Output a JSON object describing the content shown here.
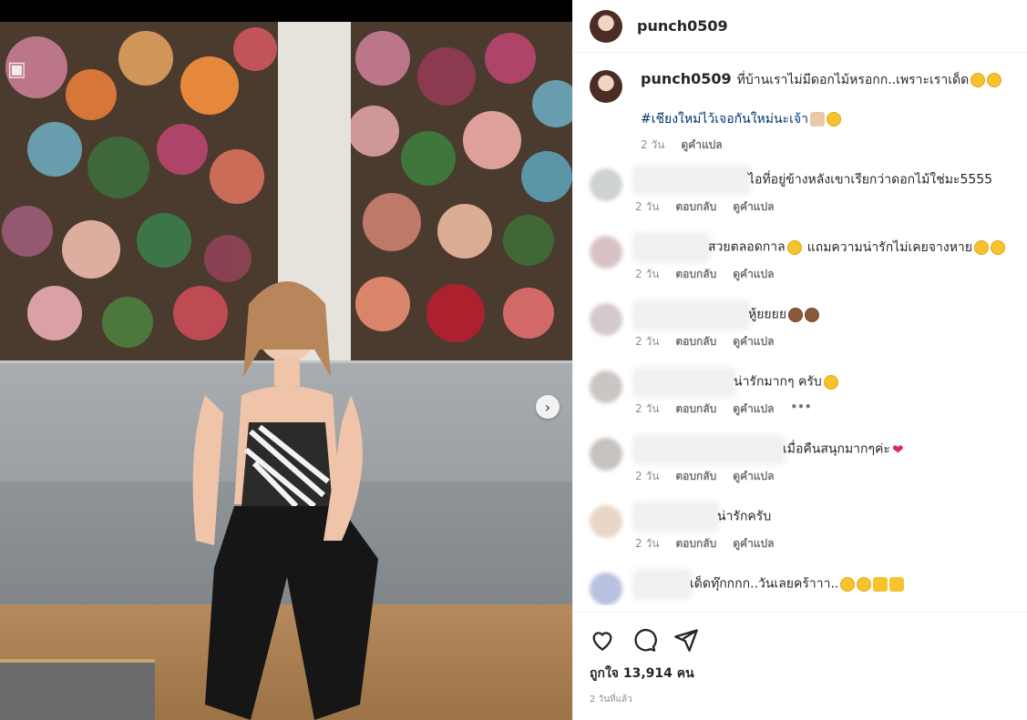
{
  "post": {
    "username": "punch0509",
    "caption": "ที่บ้านเราไม่มีดอกไม้หรอกก..เพราะเราเด็ด",
    "hashtag": "#เชียงใหม่ไว้เจอกันใหม่นะเจ้า",
    "caption_time": "2 วัน",
    "translate_label": "ดูคำแปล"
  },
  "comments": [
    {
      "text": "ไอที่อยู่ข้างหลังเขาเรียกว่าดอกไม้ใช่มะ5555",
      "time": "2 วัน",
      "emojis": [],
      "more": false,
      "name_w": 124,
      "avatar": "#cfd3cf"
    },
    {
      "text": "สวยตลอดกาล",
      "text2": "แถมความน่ารักไม่เคยจางหาย",
      "time": "2 วัน",
      "emojis": [
        "yellow"
      ],
      "emojis2": [
        "yellow",
        "yellow"
      ],
      "more": false,
      "name_w": 80,
      "avatar": "#d9c2c6"
    },
    {
      "text": "หู้ยยยย",
      "time": "2 วัน",
      "emojis": [
        "monkey",
        "monkey"
      ],
      "more": false,
      "name_w": 124,
      "avatar": "#d3c9cf"
    },
    {
      "text": "น่ารักมากๆ ครับ",
      "time": "2 วัน",
      "emojis": [
        "yellow"
      ],
      "more": true,
      "name_w": 108,
      "avatar": "#cbc6c4"
    },
    {
      "text": "เมื่อคืนสนุกมากๆค่ะ",
      "time": "2 วัน",
      "emojis": [
        "heart"
      ],
      "more": false,
      "name_w": 162,
      "avatar": "#c7c2bf"
    },
    {
      "text": "น่ารักครับ",
      "time": "2 วัน",
      "emojis": [],
      "more": false,
      "name_w": 90,
      "avatar": "#e9d6c6"
    },
    {
      "text": "เด็ดทุ๊กกกก..วันเลยคร้าาา..",
      "time": "2 วัน",
      "emojis": [
        "yellow",
        "yellow",
        "thumb",
        "thumb"
      ],
      "more": false,
      "name_w": 60,
      "avatar": "#b8c1dd"
    }
  ],
  "labels": {
    "reply": "ตอบกลับ",
    "translate": "ดูคำแปล",
    "more": "•••"
  },
  "footer": {
    "likes": "ถูกใจ 13,914 คน",
    "ago": "2 วันที่แล้ว"
  },
  "colors": {
    "link": "#00376b",
    "meta": "#8e8e8e"
  }
}
